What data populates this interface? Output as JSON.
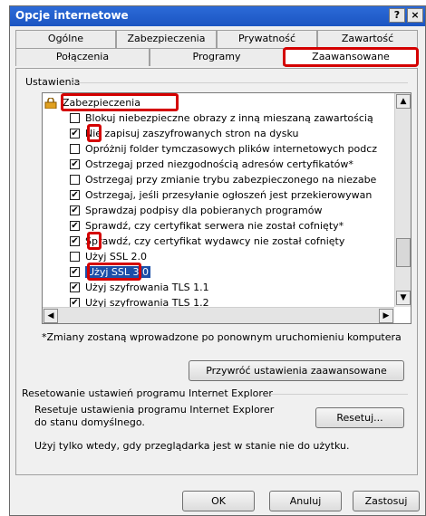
{
  "window": {
    "title": "Opcje internetowe",
    "help_glyph": "?",
    "close_glyph": "×"
  },
  "tabs_row1": [
    {
      "label": "Ogólne"
    },
    {
      "label": "Zabezpieczenia"
    },
    {
      "label": "Prywatność"
    },
    {
      "label": "Zawartość"
    }
  ],
  "tabs_row2": [
    {
      "label": "Połączenia"
    },
    {
      "label": "Programy"
    },
    {
      "label": "Zaawansowane",
      "active": true
    }
  ],
  "settings": {
    "group_label": "Ustawienia",
    "section_header": "Zabezpieczenia",
    "items": [
      {
        "label": "Blokuj niebezpieczne obrazy z inną mieszaną zawartością",
        "checked": false
      },
      {
        "label": "Nie zapisuj zaszyfrowanych stron na dysku",
        "checked": true
      },
      {
        "label": "Opróżnij folder tymczasowych plików internetowych podcz",
        "checked": false
      },
      {
        "label": "Ostrzegaj przed niezgodnością adresów certyfikatów*",
        "checked": true
      },
      {
        "label": "Ostrzegaj przy zmianie trybu zabezpieczonego na niezabe",
        "checked": false
      },
      {
        "label": "Ostrzegaj, jeśli przesyłanie ogłoszeń jest przekierowywan",
        "checked": true
      },
      {
        "label": "Sprawdzaj podpisy dla pobieranych programów",
        "checked": true
      },
      {
        "label": "Sprawdź, czy certyfikat serwera nie został cofnięty*",
        "checked": true
      },
      {
        "label": "Sprawdź, czy certyfikat wydawcy nie został cofnięty",
        "checked": true
      },
      {
        "label": "Użyj SSL 2.0",
        "checked": false
      },
      {
        "label": "Użyj SSL 3.0",
        "checked": true,
        "selected": true
      },
      {
        "label": "Użyj szyfrowania TLS 1.1",
        "checked": true
      },
      {
        "label": "Użyj szyfrowania TLS 1.2",
        "checked": true
      }
    ],
    "note": "*Zmiany zostaną wprowadzone po ponownym uruchomieniu komputera",
    "restore_button": "Przywróć ustawienia zaawansowane"
  },
  "reset": {
    "group_label": "Resetowanie ustawień programu Internet Explorer",
    "description": "Resetuje ustawienia programu Internet Explorer do stanu domyślnego.",
    "button": "Resetuj...",
    "warning": "Użyj tylko wtedy, gdy przeglądarka jest w stanie nie do użytku."
  },
  "footer": {
    "ok": "OK",
    "cancel": "Anuluj",
    "apply": "Zastosuj"
  },
  "colors": {
    "highlight_red": "#d40000",
    "title_blue": "#1b55c2",
    "selection_blue": "#1c4fa8"
  }
}
